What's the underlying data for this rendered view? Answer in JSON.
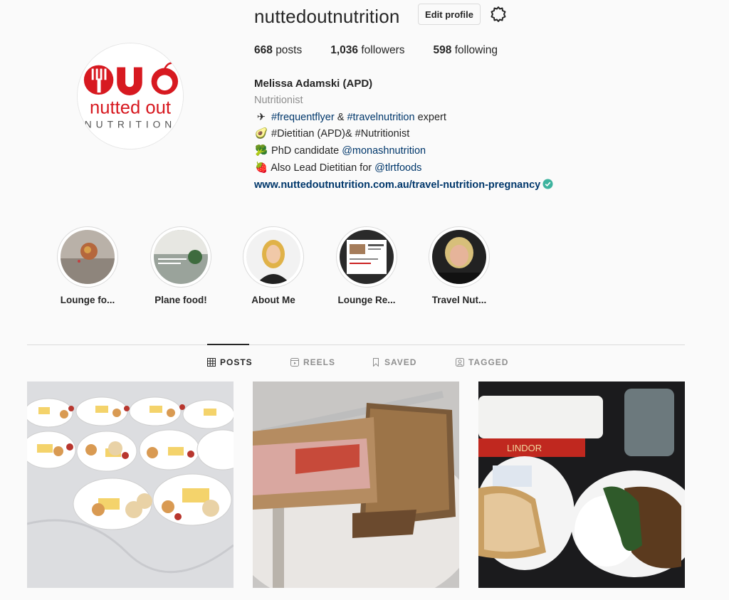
{
  "profile": {
    "username": "nuttedoutnutrition",
    "edit_label": "Edit profile",
    "avatar_logo_line1": "nutted out",
    "avatar_logo_line2": "NUTRITION"
  },
  "stats": [
    {
      "count": "668",
      "label": "posts"
    },
    {
      "count": "1,036",
      "label": "followers"
    },
    {
      "count": "598",
      "label": "following"
    }
  ],
  "bio": {
    "full_name": "Melissa Adamski (APD)",
    "category": "Nutritionist",
    "line1_emoji": "✈",
    "line1_tag1": "#frequentflyer",
    "line1_mid": "&",
    "line1_tag2": "#travelnutrition",
    "line1_end": "expert",
    "line2_emoji": "🥑",
    "line2_text": "#Dietitian (APD)& #Nutritionist",
    "line3_emoji": "🥦",
    "line3_text": "PhD candidate",
    "line3_mention": "@monashnutrition",
    "line4_emoji": "🍓",
    "line4_text": "Also Lead Dietitian for",
    "line4_mention": "@tlrtfoods",
    "website": "www.nuttedoutnutrition.com.au/travel-nutrition-pregnancy"
  },
  "highlights": [
    {
      "label": "Lounge fo..."
    },
    {
      "label": "Plane food!"
    },
    {
      "label": "About Me"
    },
    {
      "label": "Lounge Re..."
    },
    {
      "label": "Travel Nut..."
    }
  ],
  "tabs": [
    {
      "label": "POSTS",
      "icon": "grid-icon",
      "active": true
    },
    {
      "label": "REELS",
      "icon": "reels-icon",
      "active": false
    },
    {
      "label": "SAVED",
      "icon": "bookmark-icon",
      "active": false
    },
    {
      "label": "TAGGED",
      "icon": "tagged-icon",
      "active": false
    }
  ],
  "posts": [
    {
      "description_icon": "cheese-platters-photo"
    },
    {
      "description_icon": "sandwich-photo"
    },
    {
      "description_icon": "airline-meal-photo",
      "wrapper_text": "LINDOR"
    }
  ],
  "colors": {
    "link": "#00376b",
    "muted": "#8e8e8e",
    "verified": "#3db39e",
    "logo_red": "#d71920"
  }
}
